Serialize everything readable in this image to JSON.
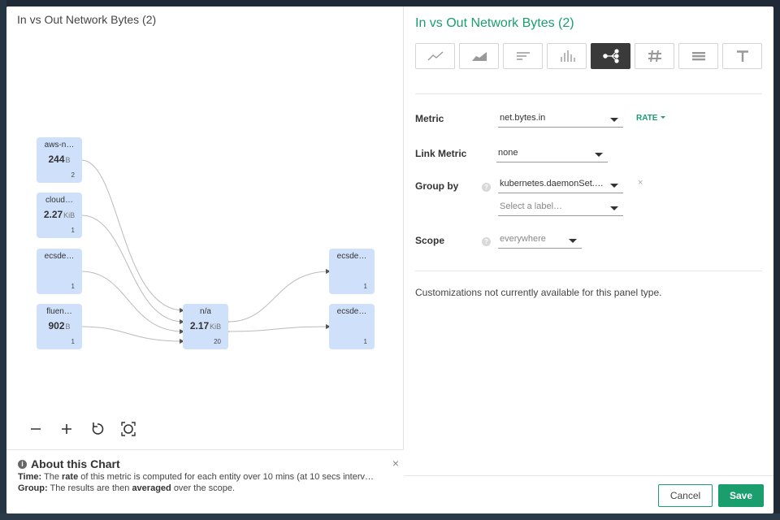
{
  "left_panel": {
    "title": "In vs Out Network Bytes (2)",
    "nodes": [
      {
        "id": "n1",
        "name": "aws-n…",
        "value": "244",
        "unit": "B",
        "count": "2"
      },
      {
        "id": "n2",
        "name": "cloud…",
        "value": "2.27",
        "unit": "KiB",
        "count": "1"
      },
      {
        "id": "n3",
        "name": "ecsde…",
        "value": "",
        "unit": "",
        "count": "1"
      },
      {
        "id": "n4",
        "name": "fluen…",
        "value": "902",
        "unit": "B",
        "count": "1"
      },
      {
        "id": "center",
        "name": "n/a",
        "value": "2.17",
        "unit": "KiB",
        "count": "20"
      },
      {
        "id": "r1",
        "name": "ecsde…",
        "value": "",
        "unit": "",
        "count": "1"
      },
      {
        "id": "r2",
        "name": "ecsde…",
        "value": "",
        "unit": "",
        "count": "1"
      }
    ],
    "zoom_controls": [
      "minus-icon",
      "plus-icon",
      "reset-icon",
      "fit-icon"
    ],
    "about": {
      "title": "About this Chart",
      "time_label": "Time:",
      "time_text_pre": "The",
      "time_bold": "rate",
      "time_text_post": "of this metric is computed for each entity over 10 mins (at 10 secs interv…",
      "group_label": "Group:",
      "group_text_pre": "The results are then",
      "group_bold": "averaged",
      "group_text_post": "over the scope."
    }
  },
  "right_panel": {
    "title": "In vs Out Network Bytes (2)",
    "viz_types": [
      "line-chart-icon",
      "area-chart-icon",
      "bar-list-icon",
      "histogram-icon",
      "topology-icon",
      "number-icon",
      "table-icon",
      "text-icon"
    ],
    "active_viz": "topology-icon",
    "form": {
      "metric_label": "Metric",
      "metric_value": "net.bytes.in",
      "rate_label": "RATE",
      "link_metric_label": "Link Metric",
      "link_metric_value": "none",
      "group_by_label": "Group by",
      "group_by_value": "kubernetes.daemonSet.…",
      "group_by_placeholder": "Select a label…",
      "scope_label": "Scope",
      "scope_value": "everywhere",
      "help_glyph": "?",
      "remove_glyph": "×"
    },
    "customizations_note": "Customizations not currently available for this panel type.",
    "footer": {
      "cancel_label": "Cancel",
      "save_label": "Save"
    }
  },
  "colors": {
    "accent": "#1a9e6e",
    "node_fill": "#cfe0fb",
    "active_viz": "#3a3a3a"
  }
}
